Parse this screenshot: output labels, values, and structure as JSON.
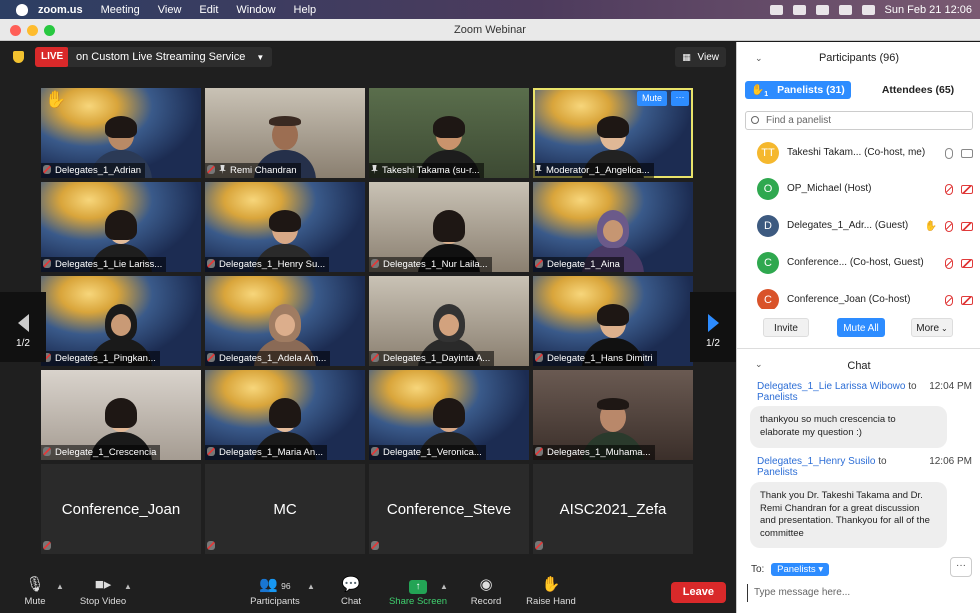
{
  "menubar": {
    "app": "zoom.us",
    "items": [
      "Meeting",
      "View",
      "Edit",
      "Window",
      "Help"
    ],
    "clock": "Sun Feb 21  12:06"
  },
  "window": {
    "title": "Zoom Webinar"
  },
  "topbar": {
    "live_badge": "LIVE",
    "stream_label": "on Custom Live Streaming Service",
    "view_label": "View"
  },
  "tiles": [
    {
      "name": "Delegates_1_Adrian"
    },
    {
      "name": "Remi Chandran"
    },
    {
      "name": "Takeshi Takama (su-r..."
    },
    {
      "name": "Moderator_1_Angelica..."
    },
    {
      "name": "Delegates_1_Lie Lariss..."
    },
    {
      "name": "Delegates_1_Henry Su..."
    },
    {
      "name": "Delegates_1_Nur Laila..."
    },
    {
      "name": "Delegate_1_Aina"
    },
    {
      "name": "Delegates_1_Pingkan..."
    },
    {
      "name": "Delegates_1_Adela Am..."
    },
    {
      "name": "Delegates_1_Dayinta A..."
    },
    {
      "name": "Delegate_1_Hans Dimitri"
    },
    {
      "name": "Delegate_1_Crescencia"
    },
    {
      "name": "Delegates_1_Maria An..."
    },
    {
      "name": "Delegate_1_Veronica..."
    },
    {
      "name": "Delegates_1_Muhama..."
    },
    {
      "name": "Conference_Joan"
    },
    {
      "name": "MC"
    },
    {
      "name": "Conference_Steve"
    },
    {
      "name": "AISC2021_Zefa"
    }
  ],
  "active_tile": {
    "mute_label": "Mute",
    "more_label": "···"
  },
  "pager": {
    "page": "1/2"
  },
  "toolbar": {
    "mute": "Mute",
    "stop_video": "Stop Video",
    "participants": "Participants",
    "participants_count": "96",
    "chat": "Chat",
    "share_screen": "Share Screen",
    "record": "Record",
    "raise_hand": "Raise Hand",
    "leave": "Leave"
  },
  "participants_panel": {
    "title": "Participants (96)",
    "tab_panelists": "Panelists (31)",
    "tab_panelists_badge": "1",
    "tab_attendees": "Attendees (65)",
    "search_placeholder": "Find a panelist",
    "rows": [
      {
        "initials": "TT",
        "color": "#f5b82e",
        "name": "Takeshi Takam...  (Co-host, me)"
      },
      {
        "initials": "O",
        "color": "#2fa84f",
        "name": "OP_Michael (Host)"
      },
      {
        "initials": "D",
        "color": "#3d5a80",
        "name": "Delegates_1_Adr...  (Guest)"
      },
      {
        "initials": "C",
        "color": "#2fa84f",
        "name": "Conference...  (Co-host, Guest)"
      },
      {
        "initials": "C",
        "color": "#d9532a",
        "name": "Conference_Joan (Co-host)"
      }
    ],
    "invite": "Invite",
    "mute_all": "Mute All",
    "more": "More"
  },
  "chat_panel": {
    "title": "Chat",
    "messages": [
      {
        "from": "Delegates_1_Lie Larissa Wibowo",
        "to_word": "to",
        "to": "Panelists",
        "time": "12:04 PM",
        "text": "thankyou so much crescencia to elaborate my question :)"
      },
      {
        "from": "Delegates_1_Henry Susilo",
        "to_word": "to",
        "to": "Panelists",
        "time": "12:06 PM",
        "text": "Thank you Dr. Takeshi Takama and Dr. Remi Chandran for a great discussion and presentation. Thankyou for all of the committee"
      }
    ],
    "to_label": "To:",
    "to_target": "Panelists",
    "input_placeholder": "Type message here...",
    "more_label": "···"
  }
}
